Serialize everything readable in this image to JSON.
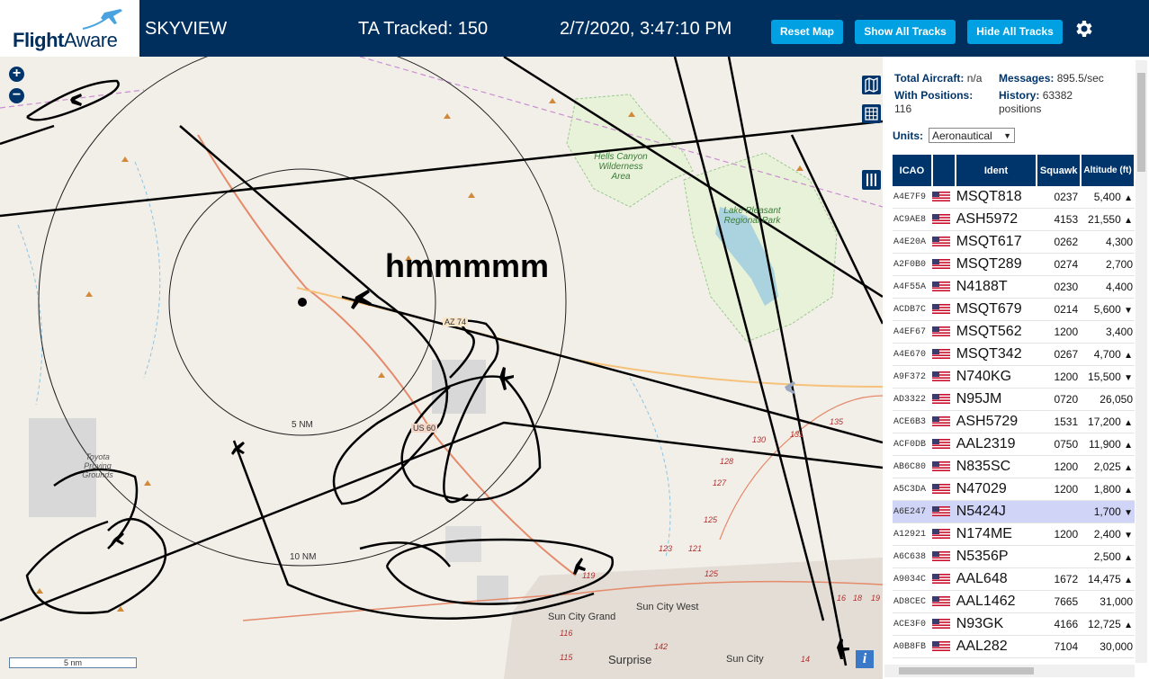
{
  "header": {
    "logo_flight": "Flight",
    "logo_aware": "Aware",
    "title": "SKYVIEW",
    "tracked": "TA Tracked: 150",
    "datetime": "2/7/2020, 3:47:10 PM",
    "reset_map": "Reset Map",
    "show_tracks": "Show All Tracks",
    "hide_tracks": "Hide All Tracks",
    "gear_icon": "gear-icon"
  },
  "map": {
    "annotation": "hmmmmm",
    "ring_5": "5 NM",
    "ring_10": "10 NM",
    "scale": "5 nm",
    "labels": {
      "hells_canyon": "Hells Canyon Wilderness Area",
      "lake_pleasant": "Lake Pleasant Regional Park",
      "toyota": "Toyota Proving Grounds",
      "sun_city_grand": "Sun City Grand",
      "sun_city_west": "Sun City West",
      "surprise": "Surprise",
      "sun_city": "Sun City",
      "az74": "AZ 74",
      "us60": "US 60"
    },
    "road_numbers": [
      "135",
      "130",
      "131",
      "128",
      "127",
      "125",
      "123",
      "121",
      "119",
      "116",
      "115",
      "142",
      "14",
      "16",
      "18",
      "19",
      "125"
    ]
  },
  "stats": {
    "total_label": "Total Aircraft:",
    "total_value": "n/a",
    "messages_label": "Messages:",
    "messages_value": "895.5/sec",
    "positions_label": "With Positions:",
    "positions_value": "116",
    "history_label": "History:",
    "history_value": "63382",
    "history_unit": "positions"
  },
  "units": {
    "label": "Units:",
    "value": "Aeronautical"
  },
  "table": {
    "headers": {
      "icao": "ICAO",
      "ident": "Ident",
      "squawk": "Squawk",
      "altitude": "Altitude (ft)"
    },
    "rows": [
      {
        "icao": "A4E7F9",
        "ident": "MSQT818",
        "squawk": "0237",
        "alt": "5,400",
        "trend": "▲"
      },
      {
        "icao": "AC9AE8",
        "ident": "ASH5972",
        "squawk": "4153",
        "alt": "21,550",
        "trend": "▲"
      },
      {
        "icao": "A4E20A",
        "ident": "MSQT617",
        "squawk": "0262",
        "alt": "4,300",
        "trend": ""
      },
      {
        "icao": "A2F0B0",
        "ident": "MSQT289",
        "squawk": "0274",
        "alt": "2,700",
        "trend": ""
      },
      {
        "icao": "A4F55A",
        "ident": "N4188T",
        "squawk": "0230",
        "alt": "4,400",
        "trend": ""
      },
      {
        "icao": "ACDB7C",
        "ident": "MSQT679",
        "squawk": "0214",
        "alt": "5,600",
        "trend": "▼"
      },
      {
        "icao": "A4EF67",
        "ident": "MSQT562",
        "squawk": "1200",
        "alt": "3,400",
        "trend": ""
      },
      {
        "icao": "A4E670",
        "ident": "MSQT342",
        "squawk": "0267",
        "alt": "4,700",
        "trend": "▲"
      },
      {
        "icao": "A9F372",
        "ident": "N740KG",
        "squawk": "1200",
        "alt": "15,500",
        "trend": "▼"
      },
      {
        "icao": "AD3322",
        "ident": "N95JM",
        "squawk": "0720",
        "alt": "26,050",
        "trend": ""
      },
      {
        "icao": "ACE6B3",
        "ident": "ASH5729",
        "squawk": "1531",
        "alt": "17,200",
        "trend": "▲"
      },
      {
        "icao": "ACF0DB",
        "ident": "AAL2319",
        "squawk": "0750",
        "alt": "11,900",
        "trend": "▲"
      },
      {
        "icao": "AB6C80",
        "ident": "N835SC",
        "squawk": "1200",
        "alt": "2,025",
        "trend": "▲"
      },
      {
        "icao": "A5C3DA",
        "ident": "N47029",
        "squawk": "1200",
        "alt": "1,800",
        "trend": "▲"
      },
      {
        "icao": "A6E247",
        "ident": "N5424J",
        "squawk": "",
        "alt": "1,700",
        "trend": "▼"
      },
      {
        "icao": "A12921",
        "ident": "N174ME",
        "squawk": "1200",
        "alt": "2,400",
        "trend": "▼"
      },
      {
        "icao": "A6C638",
        "ident": "N5356P",
        "squawk": "",
        "alt": "2,500",
        "trend": "▲"
      },
      {
        "icao": "A9034C",
        "ident": "AAL648",
        "squawk": "1672",
        "alt": "14,475",
        "trend": "▲"
      },
      {
        "icao": "AD8CEC",
        "ident": "AAL1462",
        "squawk": "7665",
        "alt": "31,000",
        "trend": ""
      },
      {
        "icao": "ACE3F0",
        "ident": "N93GK",
        "squawk": "4166",
        "alt": "12,725",
        "trend": "▲"
      },
      {
        "icao": "A0B8FB",
        "ident": "AAL282",
        "squawk": "7104",
        "alt": "30,000",
        "trend": ""
      }
    ],
    "selected_index": 14
  }
}
